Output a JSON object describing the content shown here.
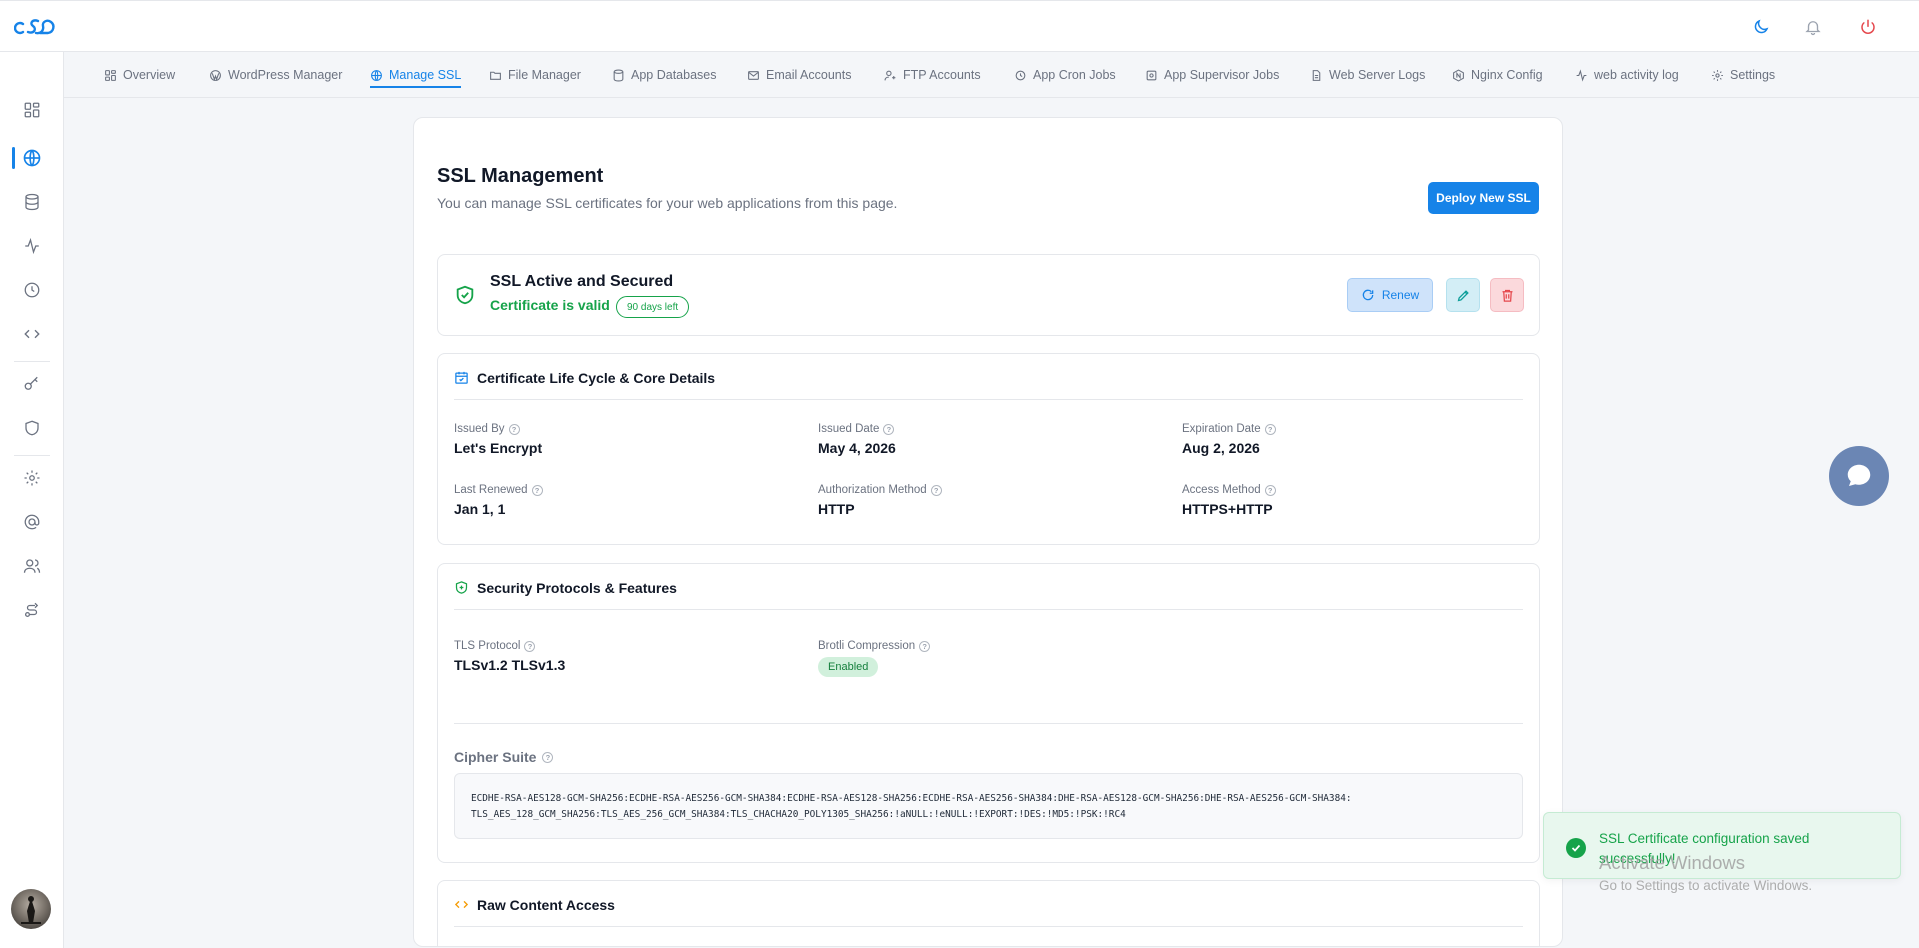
{
  "tabs": [
    {
      "label": "Overview",
      "icon": "overview-icon"
    },
    {
      "label": "WordPress Manager",
      "icon": "wordpress-icon"
    },
    {
      "label": "Manage SSL",
      "icon": "globe-icon",
      "active": true
    },
    {
      "label": "File Manager",
      "icon": "folder-icon"
    },
    {
      "label": "App Databases",
      "icon": "database-icon"
    },
    {
      "label": "Email Accounts",
      "icon": "mail-icon"
    },
    {
      "label": "FTP Accounts",
      "icon": "user-plus-icon"
    },
    {
      "label": "App Cron Jobs",
      "icon": "cron-icon"
    },
    {
      "label": "App Supervisor Jobs",
      "icon": "supervisor-icon"
    },
    {
      "label": "Web Server Logs",
      "icon": "file-icon"
    },
    {
      "label": "Nginx Config",
      "icon": "nginx-icon"
    },
    {
      "label": "web activity log",
      "icon": "activity-icon"
    },
    {
      "label": "Settings",
      "icon": "gear-icon"
    }
  ],
  "header": {
    "title": "SSL Management",
    "subtitle": "You can manage SSL certificates for your web applications from this page.",
    "deploy_label": "Deploy New SSL"
  },
  "status": {
    "title": "SSL Active and Secured",
    "valid_text": "Certificate is valid",
    "days_left": "90 days left",
    "renew_label": "Renew"
  },
  "lifecycle": {
    "title": "Certificate Life Cycle & Core Details",
    "issued_by_label": "Issued By",
    "issued_by": "Let's Encrypt",
    "issued_date_label": "Issued Date",
    "issued_date": "May 4, 2026",
    "expiration_label": "Expiration Date",
    "expiration": "Aug 2, 2026",
    "last_renewed_label": "Last Renewed",
    "last_renewed": "Jan 1, 1",
    "auth_method_label": "Authorization Method",
    "auth_method": "HTTP",
    "access_method_label": "Access Method",
    "access_method": "HTTPS+HTTP"
  },
  "security": {
    "title": "Security Protocols & Features",
    "tls_label": "TLS Protocol",
    "tls": "TLSv1.2 TLSv1.3",
    "brotli_label": "Brotli Compression",
    "brotli": "Enabled",
    "cipher_label": "Cipher Suite",
    "cipher_line1": "ECDHE-RSA-AES128-GCM-SHA256:ECDHE-RSA-AES256-GCM-SHA384:ECDHE-RSA-AES128-SHA256:ECDHE-RSA-AES256-SHA384:DHE-RSA-AES128-GCM-SHA256:DHE-RSA-AES256-GCM-SHA384:",
    "cipher_line2": "TLS_AES_128_GCM_SHA256:TLS_AES_256_GCM_SHA384:TLS_CHACHA20_POLY1305_SHA256:!aNULL:!eNULL:!EXPORT:!DES:!MD5:!PSK:!RC4"
  },
  "raw": {
    "title": "Raw Content Access"
  },
  "toast": {
    "message": "SSL Certificate configuration saved successfully!"
  },
  "watermark": {
    "title": "Activate Windows",
    "subtitle": "Go to Settings to activate Windows."
  },
  "colors": {
    "accent": "#1683e8",
    "success": "#16a34a",
    "danger": "#e5484d"
  }
}
